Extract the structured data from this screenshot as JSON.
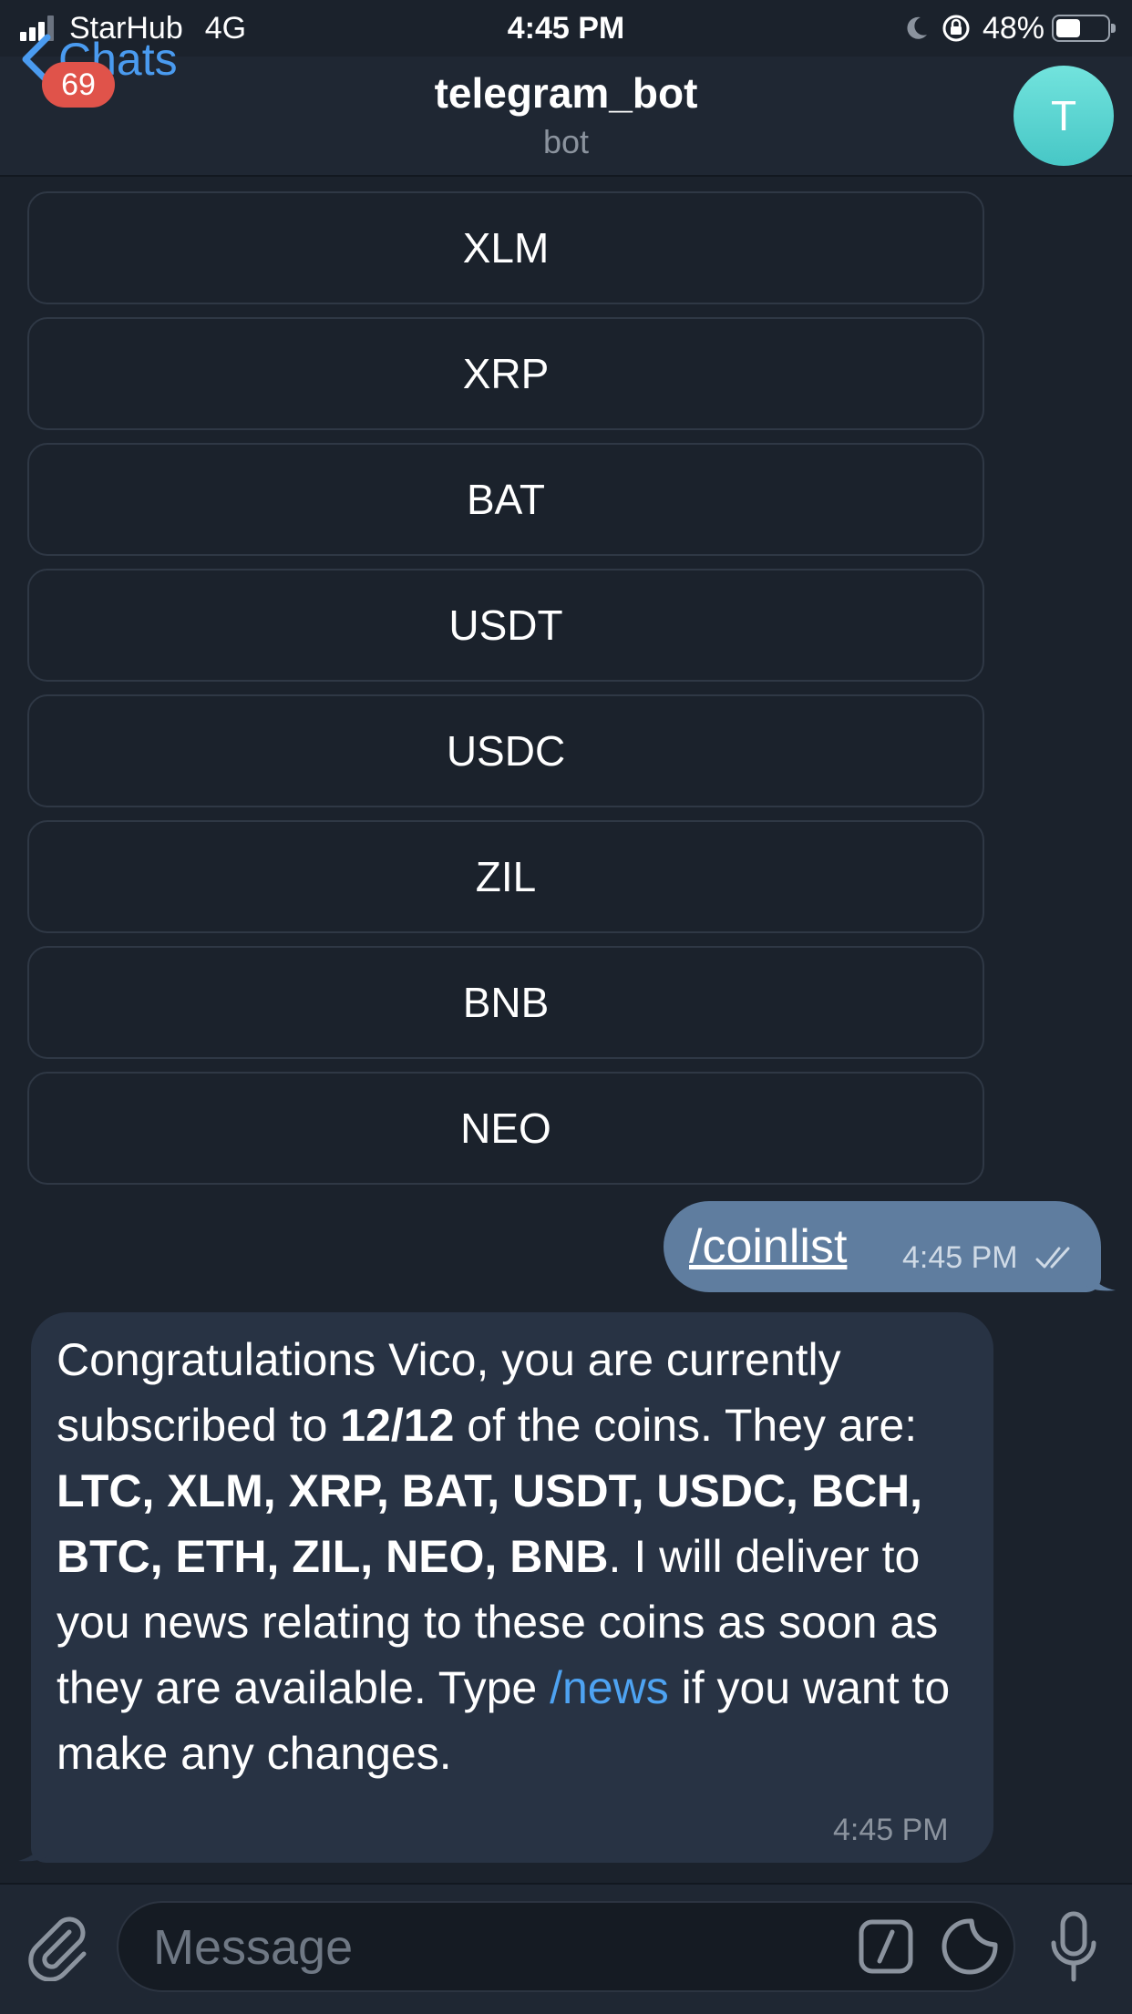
{
  "status_bar": {
    "carrier": "StarHub",
    "network": "4G",
    "time": "4:45 PM",
    "battery_percent": "48%",
    "battery_level": 0.48
  },
  "nav": {
    "back_label": "Chats",
    "unread_count": "69",
    "title": "telegram_bot",
    "subtitle": "bot",
    "avatar_letter": "T"
  },
  "keyboard_buttons": [
    {
      "label": "XLM"
    },
    {
      "label": "XRP"
    },
    {
      "label": "BAT"
    },
    {
      "label": "USDT"
    },
    {
      "label": "USDC"
    },
    {
      "label": "ZIL"
    },
    {
      "label": "BNB"
    },
    {
      "label": "NEO"
    }
  ],
  "outgoing": {
    "text": "/coinlist",
    "time": "4:45 PM"
  },
  "incoming": {
    "t1": "Congratulations Vico, you are currently subscribed to ",
    "count": "12/12",
    "t2": " of the coins. They are: ",
    "coins": "LTC, XLM, XRP, BAT, USDT, USDC, BCH, BTC, ETH, ZIL, NEO, BNB",
    "t3": ". I will deliver to you news relating to these coins as soon as they are available. Type ",
    "command": "/news",
    "t4": " if you want to make any changes.",
    "time": "4:45 PM"
  },
  "input": {
    "placeholder": "Message"
  },
  "colors": {
    "accent": "#4a9bf0",
    "badge": "#e0534a",
    "outgoing_bubble": "#5f7d9f",
    "incoming_bubble": "#283344",
    "background": "#1b222c"
  }
}
